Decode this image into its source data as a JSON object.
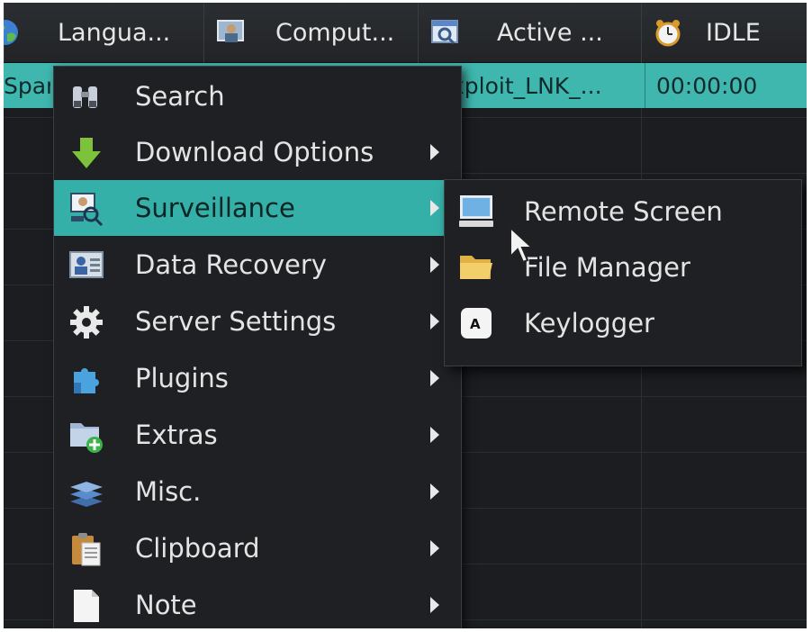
{
  "header": {
    "columns": [
      {
        "label": "Langua...",
        "icon": "globe-icon"
      },
      {
        "label": "Comput...",
        "icon": "computer-user-icon"
      },
      {
        "label": "Active ...",
        "icon": "active-window-icon"
      },
      {
        "label": "IDLE",
        "icon": "alarm-clock-icon"
      }
    ]
  },
  "selected_row": {
    "col1": "Spar",
    "col3": "xploit_LNK_...",
    "col4": "00:00:00"
  },
  "menu": {
    "items": [
      {
        "label": "Search",
        "icon": "binoculars-icon",
        "submenu": false
      },
      {
        "label": "Download Options",
        "icon": "download-arrow-icon",
        "submenu": true
      },
      {
        "label": "Surveillance",
        "icon": "surveillance-icon",
        "submenu": true,
        "active": true
      },
      {
        "label": "Data Recovery",
        "icon": "data-recovery-icon",
        "submenu": true
      },
      {
        "label": "Server Settings",
        "icon": "gear-icon",
        "submenu": true
      },
      {
        "label": "Plugins",
        "icon": "puzzle-icon",
        "submenu": true
      },
      {
        "label": "Extras",
        "icon": "folder-add-icon",
        "submenu": true
      },
      {
        "label": "Misc.",
        "icon": "layers-icon",
        "submenu": true
      },
      {
        "label": "Clipboard",
        "icon": "clipboard-icon",
        "submenu": true
      },
      {
        "label": "Note",
        "icon": "note-icon",
        "submenu": true
      }
    ]
  },
  "submenu": {
    "items": [
      {
        "label": "Remote Screen",
        "icon": "monitor-icon"
      },
      {
        "label": "File Manager",
        "icon": "folder-icon"
      },
      {
        "label": "Keylogger",
        "icon": "keyboard-key-icon"
      }
    ]
  },
  "colors": {
    "accent": "#35b0a8",
    "background": "#1b1d20",
    "text": "#e4e4e4"
  }
}
